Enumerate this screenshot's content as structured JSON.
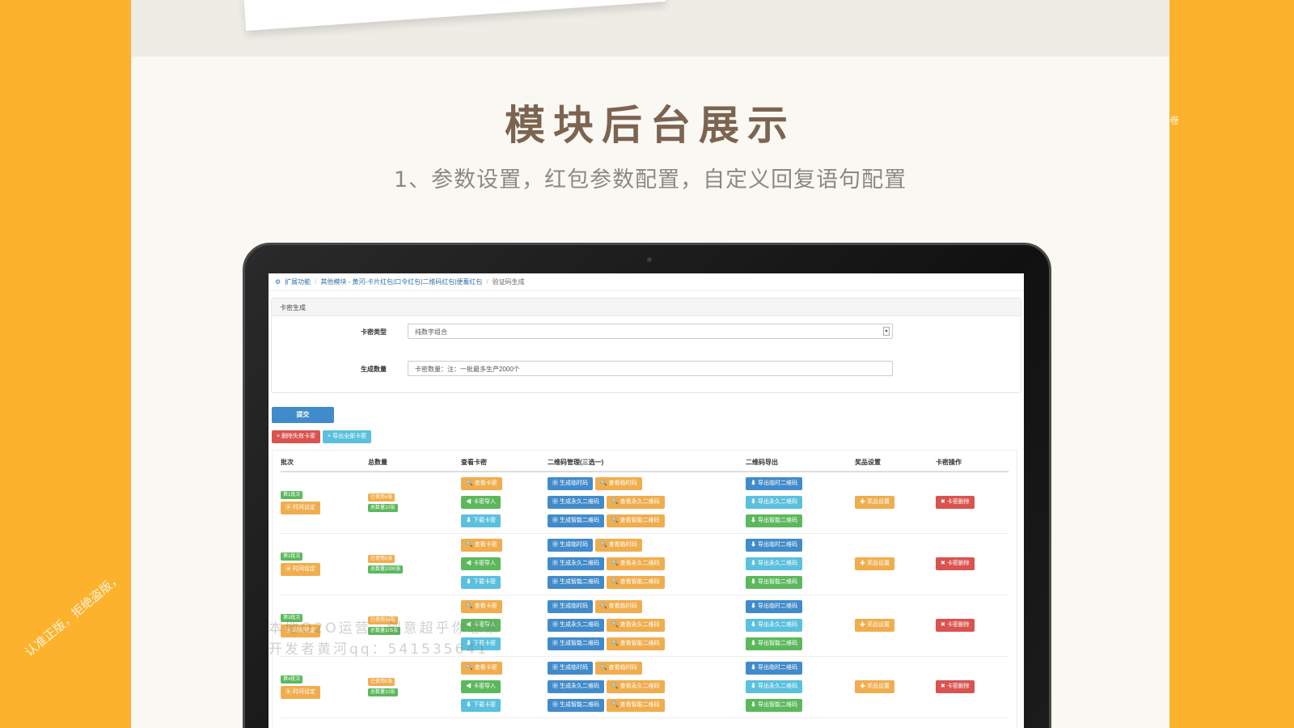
{
  "heading": "模块后台展示",
  "subheading": "1、参数设置，红包参数配置，自定义回复语句配置",
  "breadcrumb": {
    "items": [
      "扩展功能",
      "其他模块 - 黄河-卡片红包|口令红包|二维码红包|便蓄红包",
      "验证码生成"
    ]
  },
  "panel_title": "卡密生成",
  "form": {
    "type_label": "卡密类型",
    "type_value": "纯数字组合",
    "count_label": "生成数量",
    "count_placeholder": "卡密数量：注：一批最多生产2000个"
  },
  "submit_label": "提交",
  "actions": {
    "delete_invalid": "× 删除失效卡密",
    "export_all": "× 导出全部卡密"
  },
  "table": {
    "headers": [
      "批次",
      "总数量",
      "查看卡密",
      "二维码管理(三选一)",
      "二维码导出",
      "奖品设置",
      "卡密操作"
    ],
    "rows": [
      {
        "batch": "第1批次",
        "time_btn": "时间设定",
        "used": "已使用4张",
        "total": "总数量10张"
      },
      {
        "batch": "第2批次",
        "time_btn": "时间设定",
        "used": "已使用0张",
        "total": "总数量1000张"
      },
      {
        "batch": "第3批次",
        "time_btn": "时间设定",
        "used": "已使用34张",
        "total": "总数量105张"
      },
      {
        "batch": "第4批次",
        "time_btn": "时间设定",
        "used": "已使用0张",
        "total": "总数量10张"
      }
    ],
    "view_buttons": [
      "查看卡密",
      "卡密导入",
      "下载卡密"
    ],
    "qr_buttons": [
      [
        "生成临时码",
        "查看临时码"
      ],
      [
        "生成永久二维码",
        "查看永久二维码"
      ],
      [
        "生成智能二维码",
        "查看智能二维码"
      ]
    ],
    "export_buttons": [
      "导出临时二维码",
      "导出永久二维码",
      "导出智能二维码"
    ],
    "prize_btn": "奖品设置",
    "delete_btn": "卡密删除"
  },
  "watermark": {
    "line1": "本地O2O运营，创意超乎你想象",
    "line2": "开发者黄河qq：541535641"
  },
  "corner_note": "认准正版，拒绝盗版，",
  "edge_note": "卷"
}
